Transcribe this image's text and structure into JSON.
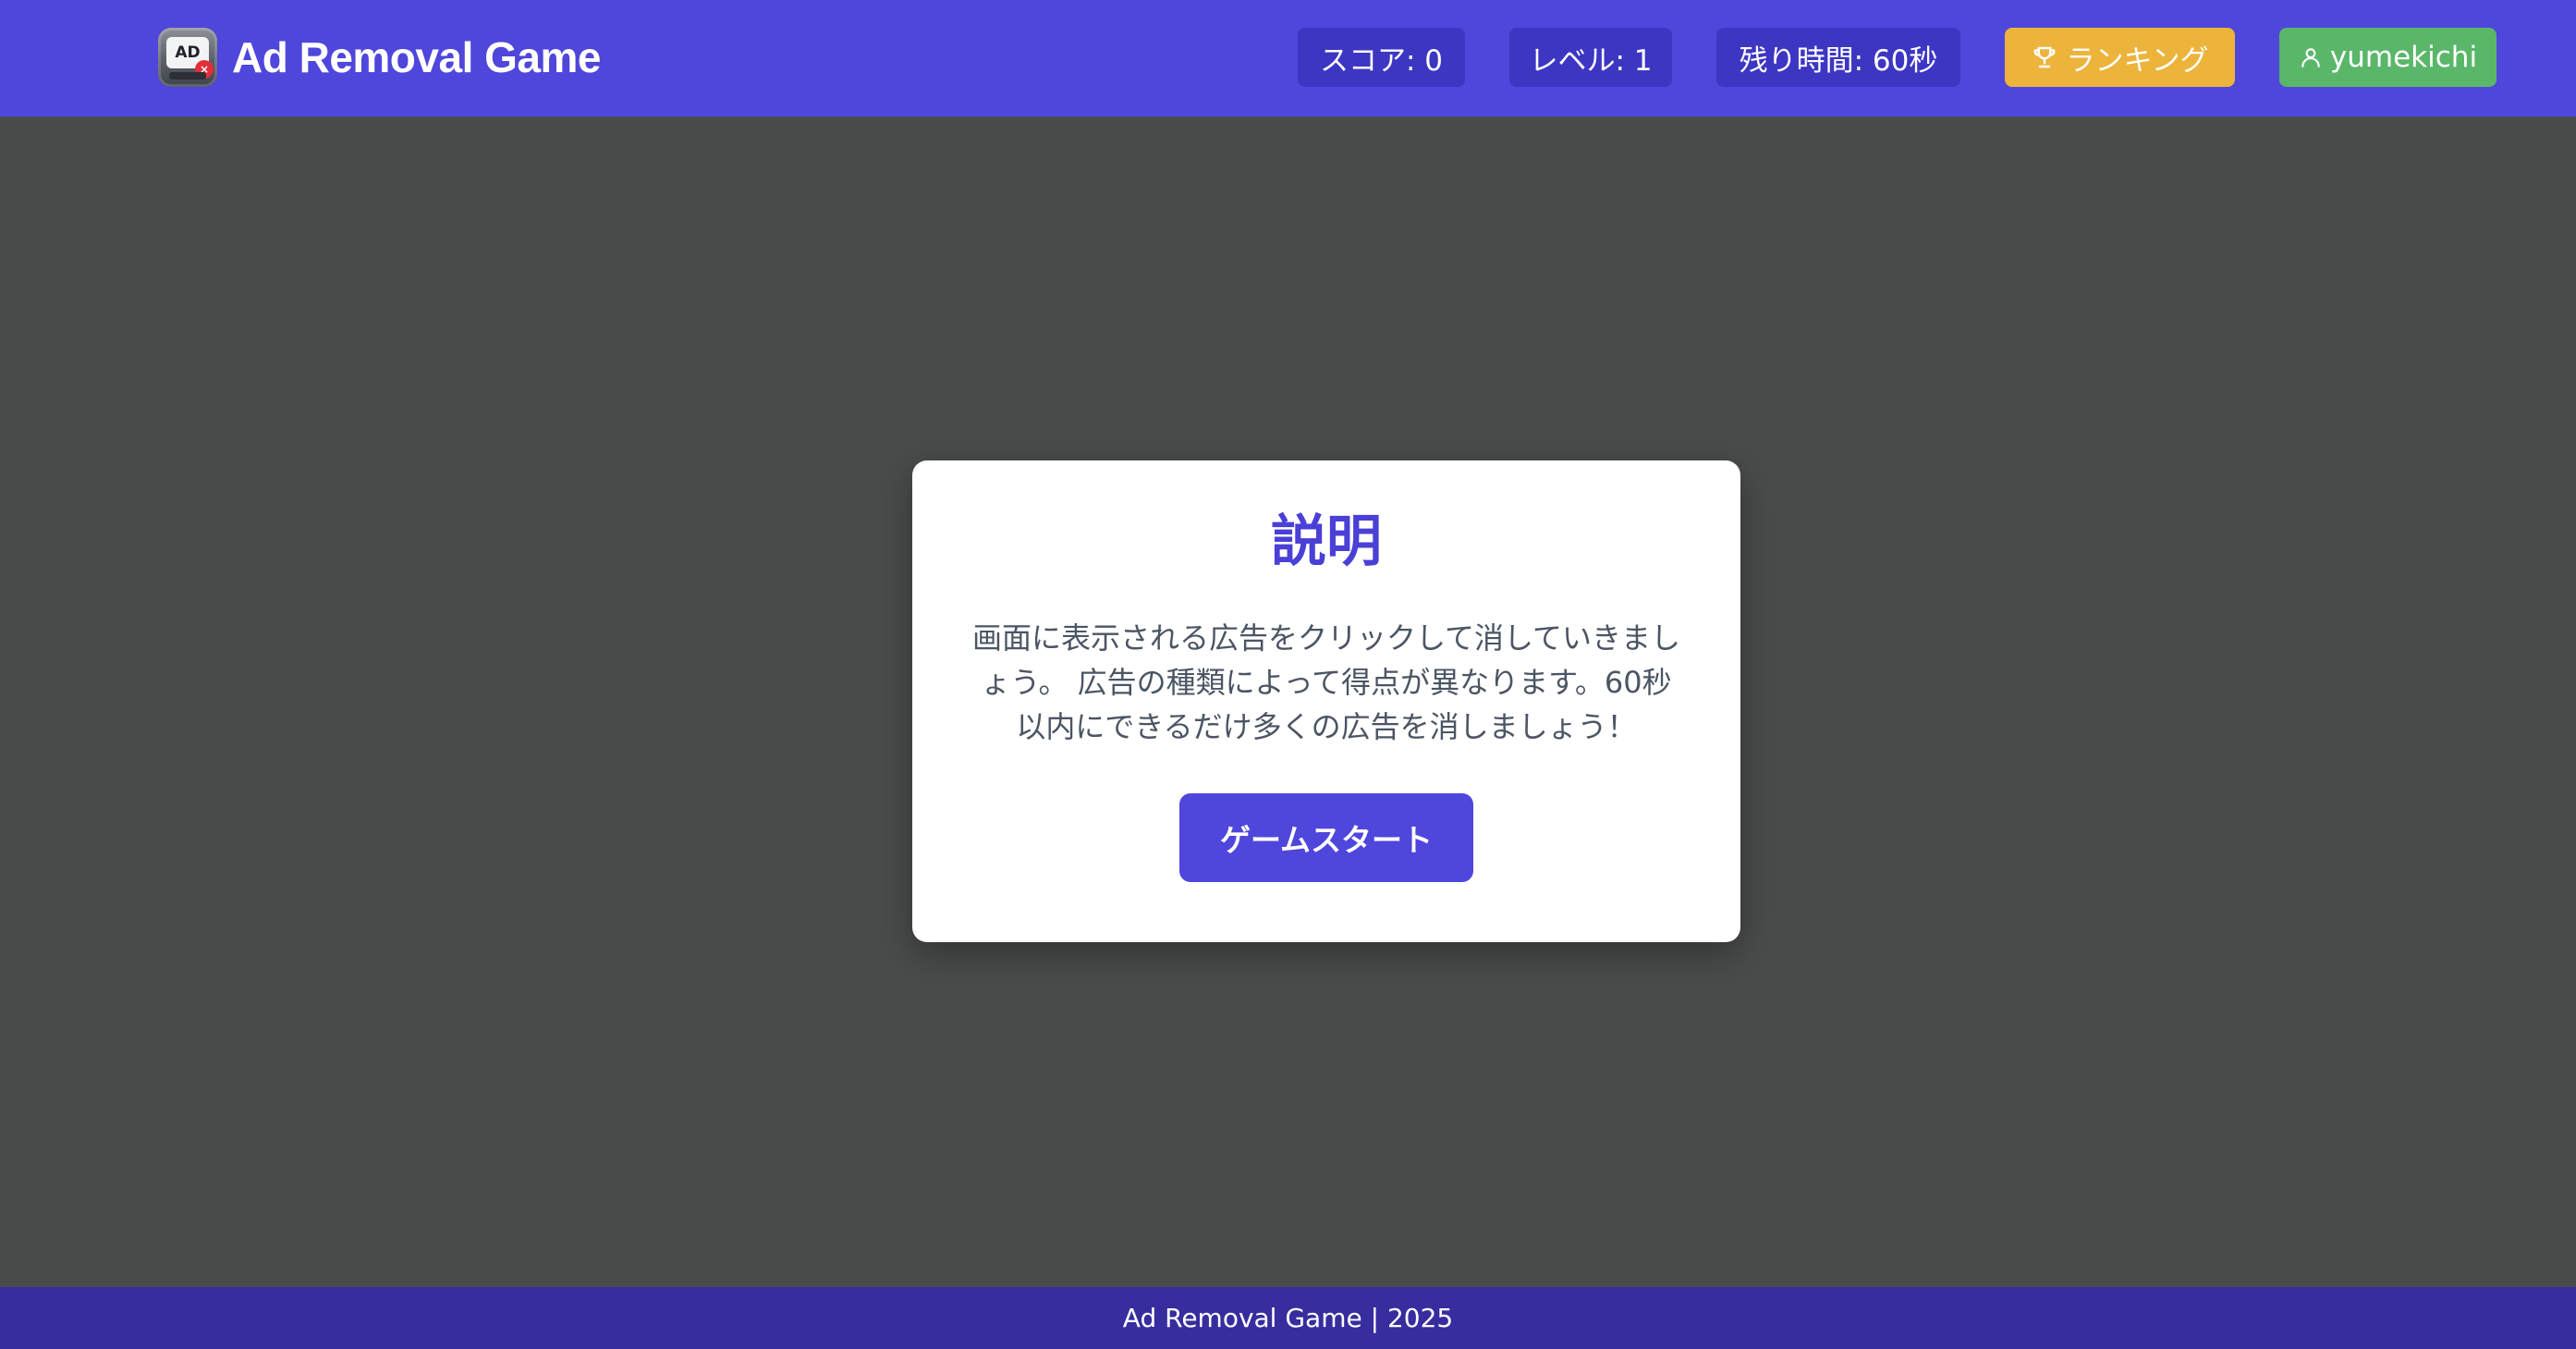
{
  "app": {
    "title": "Ad Removal Game",
    "logo": {
      "icon": "ad-block-icon",
      "screen_text": "AD",
      "badge_text": "×"
    }
  },
  "stats": {
    "score_label": "スコア: 0",
    "level_label": "レベル: 1",
    "time_label": "残り時間: 60秒"
  },
  "nav": {
    "ranking_label": "ランキング",
    "ranking_icon": "trophy-icon",
    "user_label": "yumekichi",
    "user_icon": "user-icon"
  },
  "modal": {
    "title": "説明",
    "description": "画面に表示される広告をクリックして消していきましょう。 広告の種類によって得点が異なります。60秒以内にできるだけ多くの広告を消しましょう！",
    "start_label": "ゲームスタート"
  },
  "footer": {
    "text": "Ad Removal Game | 2025"
  },
  "colors": {
    "header": "#4f46dc",
    "stat_pill": "#3d36c3",
    "ranking": "#ecb43a",
    "user": "#5ab76a",
    "background": "#4a4c4c",
    "footer": "#372d9e",
    "title_accent": "#4a40d6"
  }
}
